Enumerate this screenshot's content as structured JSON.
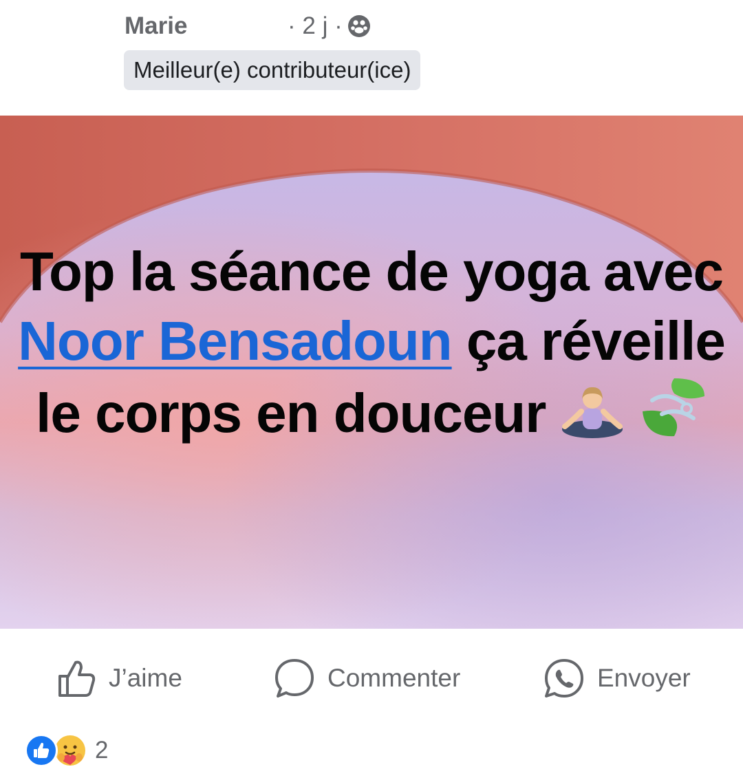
{
  "post": {
    "author": "Marie",
    "meta": "· 2 j ·",
    "audience_icon": "friends-icon",
    "badge": "Meilleur(e) contributeur(ice)",
    "text_part1": "Top la séance de yoga avec ",
    "mention": "Noor Bensadoun",
    "text_part2": " ça réveille le corps en douceur",
    "emojis": [
      "woman-in-lotus-position",
      "leaf-fluttering-in-wind"
    ]
  },
  "actions": {
    "like_label": "J’aime",
    "comment_label": "Commenter",
    "send_label": "Envoyer"
  },
  "reactions": {
    "icons": [
      "like-reaction-icon",
      "care-reaction-icon"
    ],
    "count": "2"
  },
  "colors": {
    "mention": "#1a66d6",
    "meta_gray": "#65676b",
    "like_blue": "#1877f2",
    "arch_red": "#d9746a"
  }
}
